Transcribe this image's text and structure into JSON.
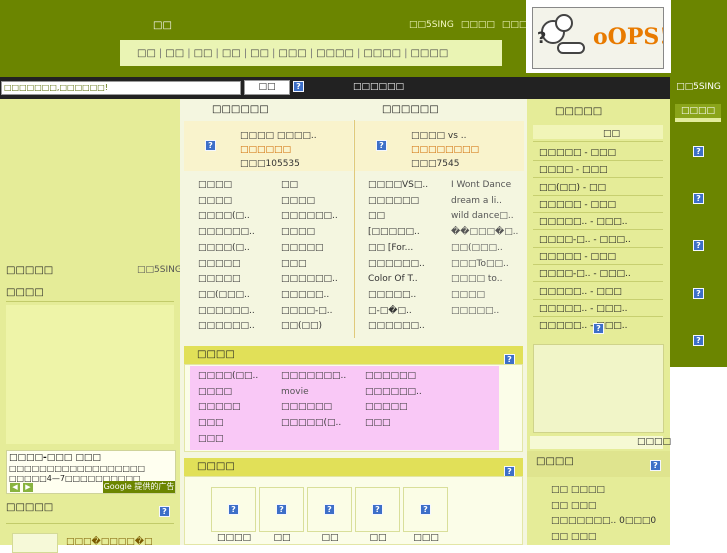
{
  "header": {
    "brand": "□□",
    "links": [
      "□□5SING",
      "□□□□",
      "□□□□"
    ],
    "nav": [
      "□□",
      "□□",
      "□□",
      "□□",
      "□□",
      "□□□",
      "□□□□",
      "□□□□",
      "□□□□"
    ]
  },
  "ad": {
    "text": "oOPS!!"
  },
  "right_bar": {
    "title": "□□5SING",
    "tab": "□□□□"
  },
  "search": {
    "value": "□□□□□□□,□□□□□□!",
    "button": "□□",
    "advanced": "□□□□□□"
  },
  "left": {
    "title": "□□□□□",
    "more": "□□5SING",
    "sub": "□□□□",
    "google": {
      "title": "□□□□-□□□ □□□",
      "text": "□□□□□□□□□□□□□□□□□□ □□□□□4—7□□□□□□□□□□",
      "ads_by": "Google 提供的广告"
    },
    "bottom_title": "□□□□□",
    "bottom_link": "□□□�□□□□�□"
  },
  "featured": [
    {
      "header": "□□□□□□",
      "line1": "□□□□ □□□□..",
      "line2": "□□□□□□",
      "line3": "□□□105535"
    },
    {
      "header": "□□□□□□",
      "line1": "□□□□ vs ..",
      "line2": "□□□□□□□□",
      "line3": "□□□7545"
    }
  ],
  "lists": {
    "c1": [
      "□□□□",
      "□□□□",
      "□□□□(□..",
      "□□□□□□..",
      "□□□□(□..",
      "□□□□□",
      "□□□□□",
      "□□(□□□..",
      "□□□□□□..",
      "□□□□□□.."
    ],
    "c2": [
      "□□",
      "□□□□",
      "□□□□□□..",
      "□□□□",
      "□□□□□",
      "□□□",
      "□□□□□□..",
      "□□□□□..",
      "□□□□-□..",
      "□□(□□)"
    ],
    "c3": [
      "□□□□VS□..",
      "□□□□□□",
      "□□",
      "[□□□□□..",
      "□□ [For...",
      "□□□□□□..",
      "Color Of T..",
      "□□□□□..",
      "□-□�□..",
      "□□□□□□.."
    ],
    "c4": [
      "I Wont Dance",
      "dream a li..",
      "wild dance□..",
      "��□□□�□..",
      "□□(□□□..",
      "□□□To□□..",
      "□□□□ to..",
      "□□□□",
      "□□□□□.."
    ]
  },
  "news": {
    "title": "□□□□",
    "c1": [
      "□□□□(□□..",
      "□□□□",
      "□□□□□",
      "□□□",
      "□□□"
    ],
    "c2": [
      "□□□□□□□..",
      "movie",
      "□□□□□□",
      "□□□□□(□.."
    ],
    "c3": [
      "□□□□□□",
      "□□□□□□..",
      "□□□□□",
      "□□□"
    ]
  },
  "photos": {
    "title": "□□□□",
    "labels": [
      "□□□□",
      "□□",
      "□□",
      "□□",
      "□□□"
    ]
  },
  "ranking": {
    "title": "□□□□□",
    "tab": "□□",
    "items": [
      "□□□□□ - □□□",
      "□□□□ - □□□",
      "□□(□□) - □□",
      "□□□□□ - □□□",
      "□□□□□.. - □□□..",
      "□□□□-□.. - □□□..",
      "□□□□□ - □□□",
      "□□□□-□.. - □□□..",
      "□□□□□.. - □□□",
      "□□□□□.. - □□□..",
      "□□□□□.. - □□□.."
    ],
    "more": "□□□□"
  },
  "stats": {
    "title": "□□□□",
    "items": [
      "□□ □□□□",
      "□□ □□□",
      "□□□□□□□.. 0□□□0",
      "□□ □□□"
    ]
  }
}
